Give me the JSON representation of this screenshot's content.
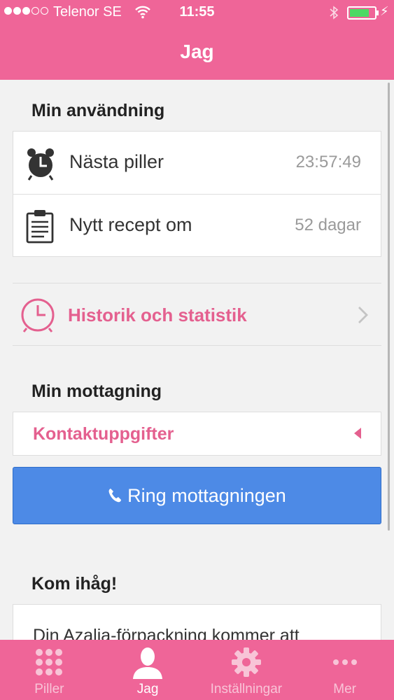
{
  "status_bar": {
    "carrier": "Telenor SE",
    "time": "11:55",
    "signal_bars_filled": 3,
    "signal_bars_total": 5,
    "battery_level": 0.78
  },
  "nav": {
    "title": "Jag"
  },
  "usage": {
    "title": "Min användning",
    "rows": [
      {
        "label": "Nästa piller",
        "value": "23:57:49",
        "icon": "alarm-clock-icon"
      },
      {
        "label": "Nytt recept om",
        "value": "52 dagar",
        "icon": "clipboard-icon"
      }
    ]
  },
  "history": {
    "label": "Historik och statistik",
    "icon": "clock-icon"
  },
  "clinic": {
    "title": "Min mottagning",
    "contact_label": "Kontaktuppgifter",
    "call_label": "Ring mottagningen"
  },
  "remember": {
    "title": "Kom ihåg!",
    "text": "Din Azalia-förpackning kommer att"
  },
  "tabs": [
    {
      "label": "Piller",
      "icon": "pill-grid-icon",
      "active": false
    },
    {
      "label": "Jag",
      "icon": "person-icon",
      "active": true
    },
    {
      "label": "Inställningar",
      "icon": "gear-icon",
      "active": false
    },
    {
      "label": "Mer",
      "icon": "more-dots-icon",
      "active": false
    }
  ],
  "colors": {
    "brand_pink": "#ef6598",
    "accent_pink_text": "#e4608f",
    "call_button_blue": "#4d8ae6"
  }
}
